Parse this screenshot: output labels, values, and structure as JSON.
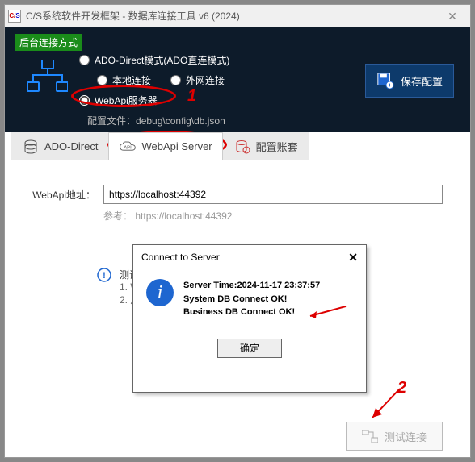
{
  "window": {
    "title": "C/S系统软件开发框架 - 数据库连接工具 v6 (2024)"
  },
  "header": {
    "mode_badge": "后台连接方式",
    "radio_ado": "ADO-Direct模式(ADO直连模式)",
    "radio_local": "本地连接",
    "radio_remote": "外网连接",
    "radio_webapi": "WebApi服务器",
    "config_label": "配置文件：",
    "config_path": "debug\\config\\db.json",
    "save_button": "保存配置"
  },
  "tabs": {
    "ado": "ADO-Direct",
    "webapi": "WebApi Server",
    "accounts": "配置账套"
  },
  "form": {
    "address_label": "WebApi地址：",
    "address_value": "https://localhost:44392",
    "hint_prefix": "参考：",
    "hint_url": "https://localhost:44392"
  },
  "test": {
    "heading": "测试",
    "step1": "W",
    "step2": "启"
  },
  "buttons": {
    "test_connection": "测试连接"
  },
  "dialog": {
    "title": "Connect to Server",
    "line1_prefix": "Server Time:",
    "line1_time": "2024-11-17 23:37:57",
    "line2": "System DB Connect OK!",
    "line3": "Business DB Connect OK!",
    "ok": "确定"
  },
  "annotations": {
    "num1": "1",
    "num2": "2"
  }
}
